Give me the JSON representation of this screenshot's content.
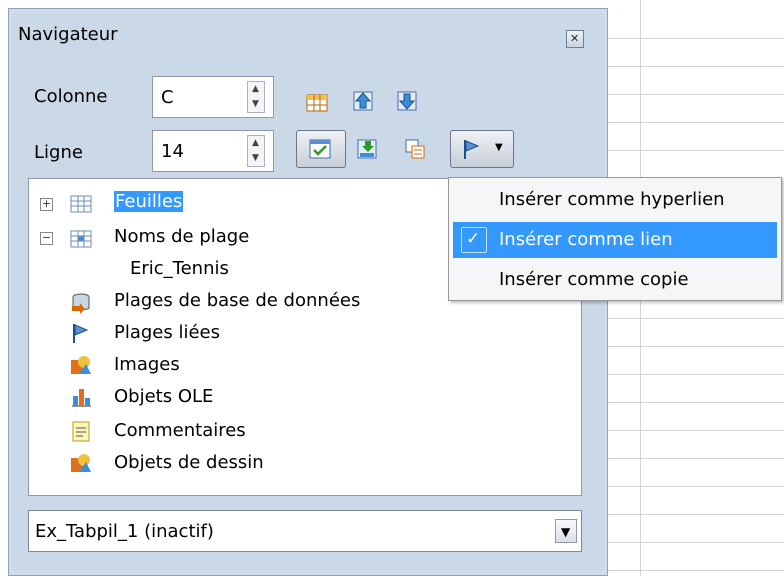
{
  "window": {
    "title": "Navigateur",
    "close_icon": "close-icon"
  },
  "fields": {
    "column": {
      "label": "Colonne",
      "value": "C"
    },
    "row": {
      "label": "Ligne",
      "value": "14"
    }
  },
  "toolbar": {
    "icons": [
      "data-range-icon",
      "start-icon",
      "end-icon",
      "toggle-icon",
      "scenarios-icon",
      "document-switch-icon",
      "drag-mode-icon"
    ]
  },
  "tree": {
    "items": [
      {
        "label": "Feuilles",
        "icon": "sheet-icon",
        "expander": "+"
      },
      {
        "label": "Noms de plage",
        "icon": "range-name-icon",
        "expander": "−"
      },
      {
        "label": "Eric_Tennis"
      },
      {
        "label": "Plages de base de données",
        "icon": "database-icon"
      },
      {
        "label": "Plages liées",
        "icon": "flag-icon"
      },
      {
        "label": "Images",
        "icon": "image-icon"
      },
      {
        "label": "Objets OLE",
        "icon": "ole-object-icon"
      },
      {
        "label": "Commentaires",
        "icon": "comment-icon"
      },
      {
        "label": "Objets de dessin",
        "icon": "drawing-icon"
      }
    ]
  },
  "document_select": {
    "value": "Ex_Tabpil_1 (inactif)"
  },
  "drag_menu": {
    "items": [
      {
        "label": "Insérer comme hyperlien",
        "checked": false
      },
      {
        "label": "Insérer comme lien",
        "checked": true
      },
      {
        "label": "Insérer comme copie",
        "checked": false
      }
    ]
  },
  "colors": {
    "selection": "#3399ff",
    "panel": "#cbd8e8"
  }
}
